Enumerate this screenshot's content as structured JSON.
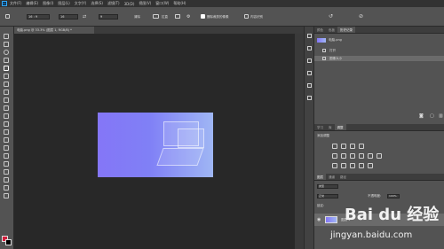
{
  "menubar": {
    "logo": "Ps",
    "items": [
      "文件(F)",
      "编辑(E)",
      "图像(I)",
      "图层(L)",
      "文字(Y)",
      "选择(S)",
      "滤镜(T)",
      "3D(D)",
      "视图(V)",
      "窗口(W)",
      "帮助(H)"
    ]
  },
  "options": {
    "ratio": "16 : 9",
    "width": "16",
    "height": "9",
    "clear_label": "清除",
    "straighten_label": "拉直",
    "delete_pixels_label": "删除裁剪的像素",
    "content_aware_label": "内容识别"
  },
  "document": {
    "tab_label": "电脑.png @ 33.3% (图层 1, RGB/8) *"
  },
  "history_panel": {
    "tabs": [
      "颜色",
      "色板",
      "历史记录"
    ],
    "snapshot": "电脑.png",
    "steps": [
      "打开",
      "图像大小"
    ]
  },
  "adjust_panel": {
    "tabs": [
      "学习",
      "库",
      "调整"
    ],
    "title": "添加调整"
  },
  "layers_panel": {
    "tabs": [
      "图层",
      "通道",
      "路径"
    ],
    "kind": "类型",
    "blend": "正常",
    "opacity_label": "不透明度:",
    "opacity": "100%",
    "lock_label": "锁定:",
    "layer_name": "图层 1"
  },
  "watermark": {
    "text": "Bai du 经验",
    "url": "jingyan.baidu.com"
  }
}
